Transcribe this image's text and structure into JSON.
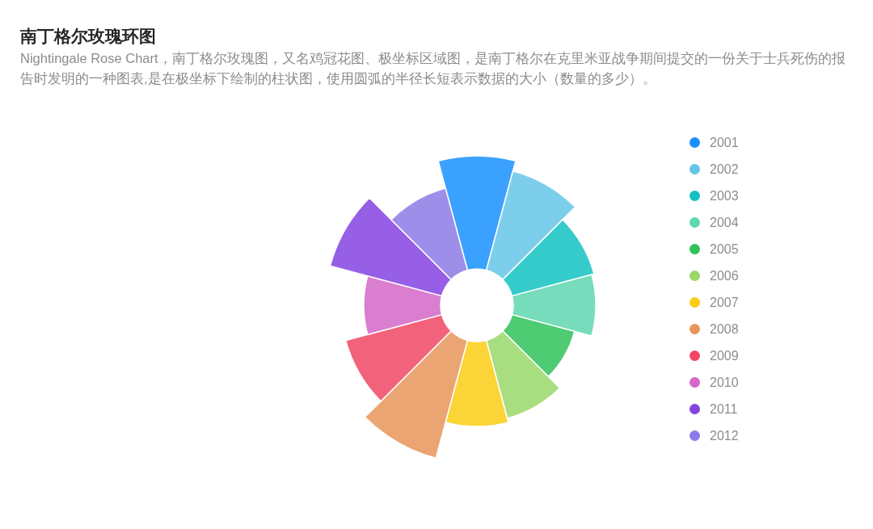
{
  "title": "南丁格尔玫瑰环图",
  "description": "Nightingale Rose Chart，南丁格尔玫瑰图，又名鸡冠花图、极坐标区域图，是南丁格尔在克里米亚战争期间提交的一份关于士兵死伤的报告时发明的一种图表,是在极坐标下绘制的柱状图，使用圆弧的半径长短表示数据的大小（数量的多少）。",
  "legend": [
    {
      "label": "2001",
      "color": "#1890ff"
    },
    {
      "label": "2002",
      "color": "#66c5e8"
    },
    {
      "label": "2003",
      "color": "#13c2c2"
    },
    {
      "label": "2004",
      "color": "#5fd6b0"
    },
    {
      "label": "2005",
      "color": "#2fc25b"
    },
    {
      "label": "2006",
      "color": "#9ad86a"
    },
    {
      "label": "2007",
      "color": "#facc14"
    },
    {
      "label": "2008",
      "color": "#e8955a"
    },
    {
      "label": "2009",
      "color": "#f04864"
    },
    {
      "label": "2010",
      "color": "#d467c8"
    },
    {
      "label": "2011",
      "color": "#8543e0"
    },
    {
      "label": "2012",
      "color": "#8c7ae6"
    }
  ]
}
